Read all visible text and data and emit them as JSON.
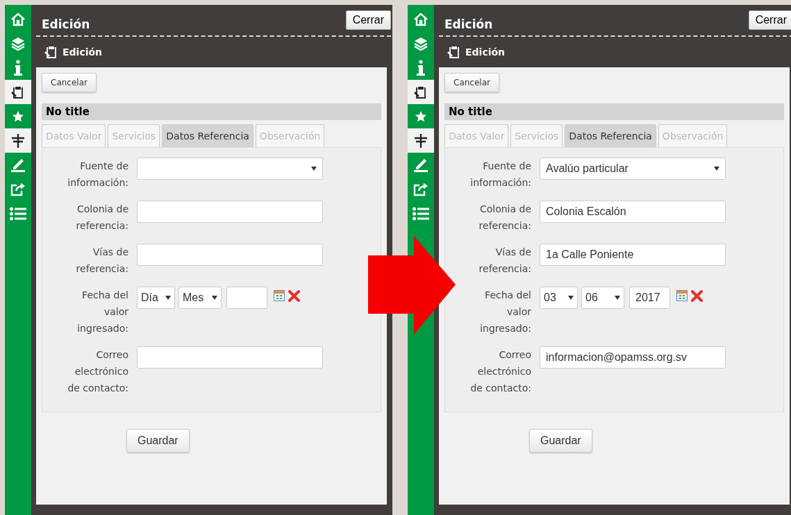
{
  "screens": [
    {
      "sidebar": {
        "items": [
          {
            "kind": "home",
            "selected": false
          },
          {
            "kind": "layers",
            "selected": false
          },
          {
            "kind": "info",
            "selected": false
          },
          {
            "kind": "edit",
            "selected": true
          },
          {
            "kind": "star",
            "selected": false
          },
          {
            "kind": "signpost",
            "selected": true
          },
          {
            "kind": "measure",
            "selected": false
          },
          {
            "kind": "share",
            "selected": false
          },
          {
            "kind": "list",
            "selected": false
          }
        ]
      },
      "header": {
        "title": "Edición",
        "close_button": "Cerrar"
      },
      "section_title": "Edición",
      "cancel_button": "Cancelar",
      "form_title": "No title",
      "tabs": [
        {
          "label": "Datos Valor",
          "selected": false
        },
        {
          "label": "Servicios",
          "selected": false
        },
        {
          "label": "Datos Referencia",
          "selected": true
        },
        {
          "label": "Observación",
          "selected": false
        }
      ],
      "fields": [
        {
          "kind": "select",
          "label": "Fuente de información:"
        },
        {
          "kind": "text",
          "label": "Colonia de referencia:"
        },
        {
          "kind": "text",
          "label": "Vías de referencia:"
        },
        {
          "kind": "date",
          "label": "Fecha del valor ingresado:",
          "day": "Día",
          "month": "Mes"
        },
        {
          "kind": "text",
          "label": "Correo electrónico de contacto:"
        }
      ],
      "save_button": "Guardar"
    },
    {
      "sidebar": {
        "items": [
          {
            "kind": "home",
            "selected": false
          },
          {
            "kind": "layers",
            "selected": false
          },
          {
            "kind": "info",
            "selected": false
          },
          {
            "kind": "edit",
            "selected": true
          },
          {
            "kind": "star",
            "selected": false
          },
          {
            "kind": "signpost",
            "selected": true
          },
          {
            "kind": "measure",
            "selected": false
          },
          {
            "kind": "share",
            "selected": false
          },
          {
            "kind": "list",
            "selected": false
          }
        ]
      },
      "header": {
        "title": "Edición",
        "close_button": "Cerrar"
      },
      "section_title": "Edición",
      "cancel_button": "Cancelar",
      "form_title": "No title",
      "tabs": [
        {
          "label": "Datos Valor",
          "selected": false
        },
        {
          "label": "Servicios",
          "selected": false
        },
        {
          "label": "Datos Referencia",
          "selected": true
        },
        {
          "label": "Observación",
          "selected": false
        }
      ],
      "fields": [
        {
          "kind": "select",
          "label": "Fuente de información:",
          "value": "Avalúo particular"
        },
        {
          "kind": "text",
          "label": "Colonia de referencia:",
          "value": "Colonia Escalón"
        },
        {
          "kind": "text",
          "label": "Vías de referencia:",
          "value": "1a Calle Poniente"
        },
        {
          "kind": "date",
          "label": "Fecha del valor ingresado:",
          "day": "03",
          "month": "06",
          "year": "2017"
        },
        {
          "kind": "text",
          "label": "Correo electrónico de contacto:",
          "value": "informacion@opamss.org.sv"
        }
      ],
      "save_button": "Guardar"
    }
  ]
}
